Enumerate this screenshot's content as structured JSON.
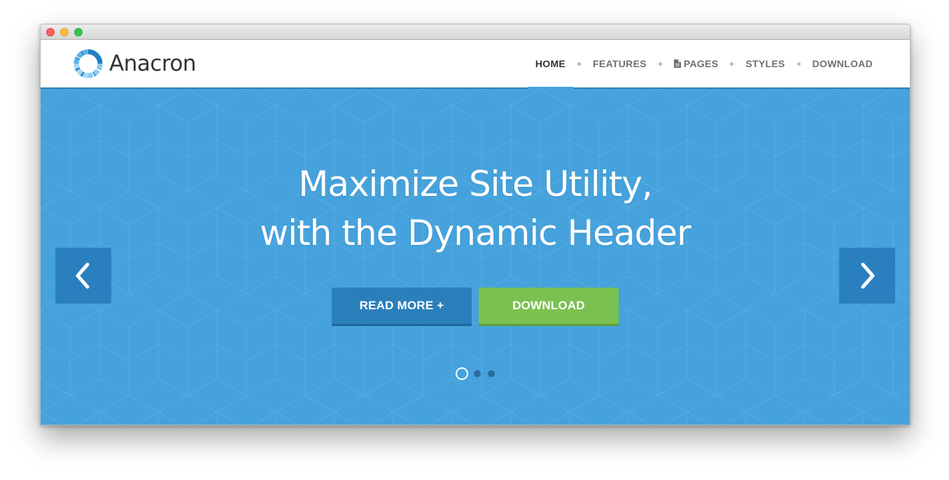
{
  "window": {
    "controls": [
      "close",
      "minimize",
      "zoom"
    ]
  },
  "brand": {
    "name": "Anacron",
    "icon": "segmented-ring-logo"
  },
  "nav": {
    "items": [
      {
        "label": "HOME",
        "active": true
      },
      {
        "label": "FEATURES",
        "active": false
      },
      {
        "label": "PAGES",
        "active": false,
        "icon": "page-icon"
      },
      {
        "label": "STYLES",
        "active": false
      },
      {
        "label": "DOWNLOAD",
        "active": false
      }
    ]
  },
  "hero": {
    "headline_line1": "Maximize Site Utility,",
    "headline_line2": "with the Dynamic Header",
    "read_more_label": "READ MORE +",
    "download_label": "DOWNLOAD",
    "prev_icon": "chevron-left-icon",
    "next_icon": "chevron-right-icon",
    "slides_total": 3,
    "active_slide": 1
  },
  "colors": {
    "hero_bg": "#45a2dc",
    "primary_button": "#2a7fbb",
    "download_button": "#7bc150",
    "nav_accent": "#4aa3dc"
  }
}
